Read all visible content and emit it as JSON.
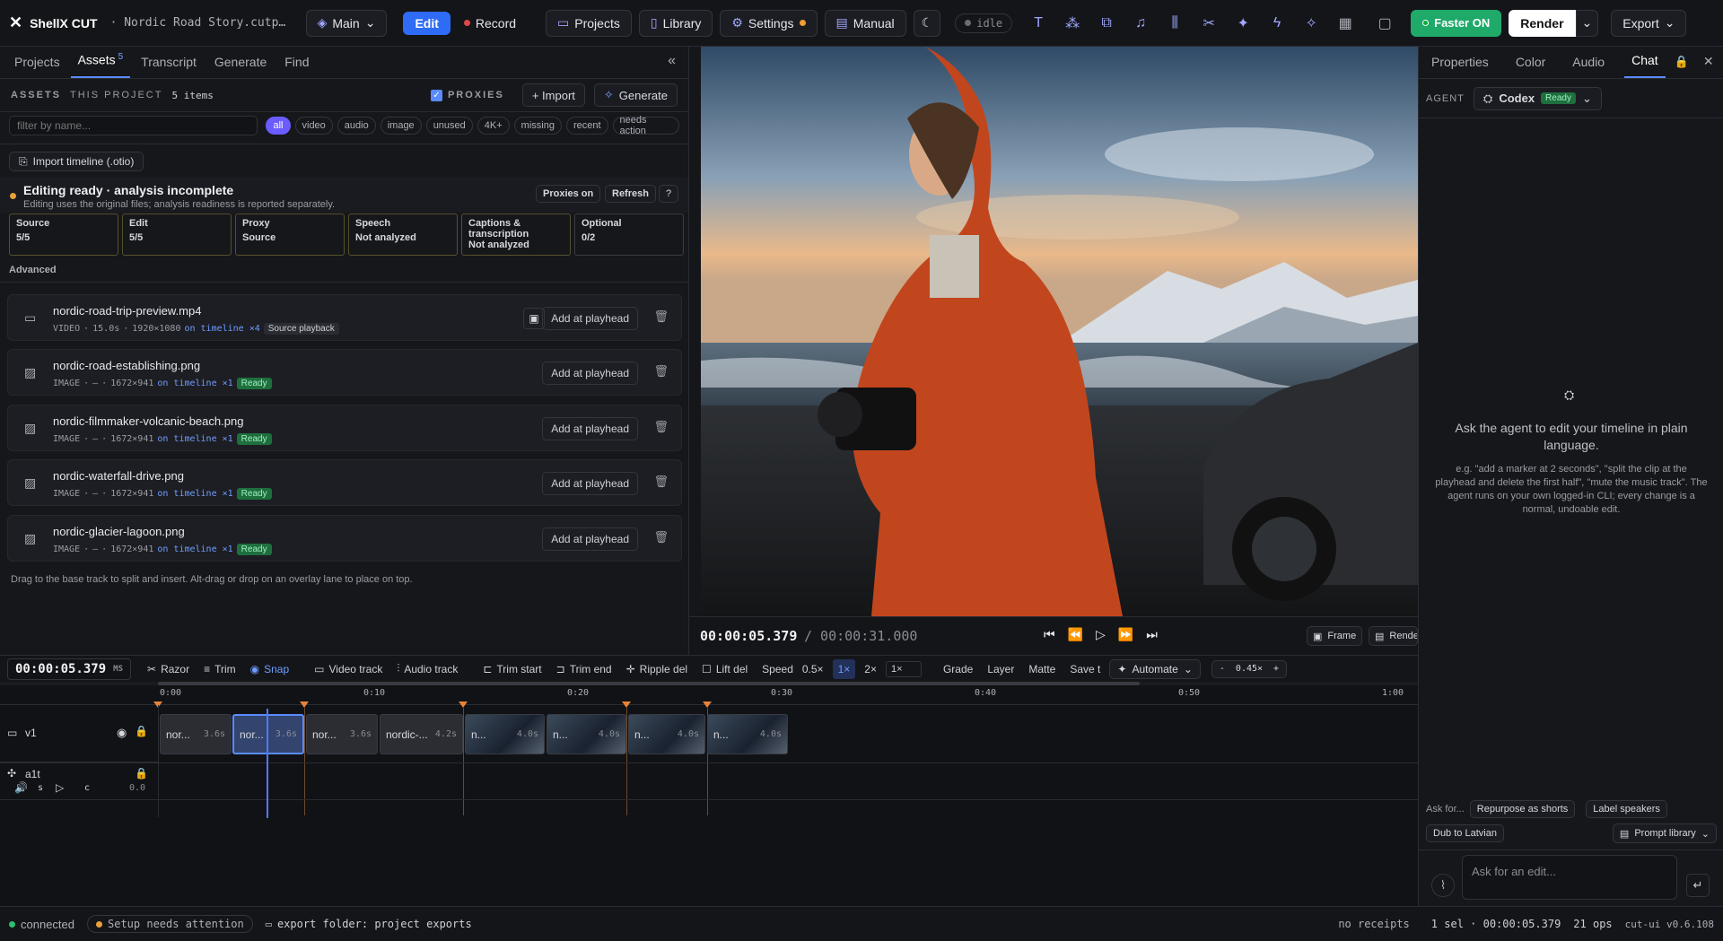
{
  "app": {
    "title": "ShellX CUT",
    "project_name": "Nordic Road Story.cutp…",
    "branch": "Main",
    "mode_edit": "Edit",
    "mode_record": "Record",
    "projects": "Projects",
    "library": "Library",
    "settings": "Settings",
    "manual": "Manual",
    "status": "idle",
    "faster": "Faster ON",
    "render": "Render",
    "export": "Export"
  },
  "left": {
    "tabs": [
      "Projects",
      "Assets",
      "Transcript",
      "Generate",
      "Find"
    ],
    "assets_count": "5",
    "assets_label": "ASSETS",
    "scope_label": "THIS PROJECT",
    "items_count": "5 items",
    "proxies_label": "PROXIES",
    "import_btn": "+ Import",
    "generate_btn": "Generate",
    "filter_placeholder": "filter by name...",
    "chips": [
      "all",
      "video",
      "audio",
      "image",
      "unused",
      "4K+",
      "missing",
      "recent",
      "needs action"
    ],
    "import_timeline": "Import timeline (.otio)",
    "status_title": "Editing ready · analysis incomplete",
    "status_sub": "Editing uses the original files; analysis readiness is reported separately.",
    "proxies_on": "Proxies on",
    "refresh": "Refresh",
    "help": "?",
    "stats": [
      {
        "label": "Source",
        "value": "5/5"
      },
      {
        "label": "Edit",
        "value": "5/5"
      },
      {
        "label": "Proxy",
        "value": "Source"
      },
      {
        "label": "Speech",
        "value": "Not analyzed"
      },
      {
        "label": "Captions & transcription",
        "value": "Not analyzed"
      },
      {
        "label": "Optional",
        "value": "0/2"
      }
    ],
    "advanced": "Advanced",
    "assets": [
      {
        "name": "nordic-road-trip-preview.mp4",
        "type": "VIDEO",
        "dur": "15.0s",
        "res": "1920×1080",
        "usage": "on timeline ×4",
        "badge": "Source playback",
        "kind": "video"
      },
      {
        "name": "nordic-road-establishing.png",
        "type": "IMAGE",
        "dur": "—",
        "res": "1672×941",
        "usage": "on timeline ×1",
        "badge": "Ready",
        "kind": "image"
      },
      {
        "name": "nordic-filmmaker-volcanic-beach.png",
        "type": "IMAGE",
        "dur": "—",
        "res": "1672×941",
        "usage": "on timeline ×1",
        "badge": "Ready",
        "kind": "image"
      },
      {
        "name": "nordic-waterfall-drive.png",
        "type": "IMAGE",
        "dur": "—",
        "res": "1672×941",
        "usage": "on timeline ×1",
        "badge": "Ready",
        "kind": "image"
      },
      {
        "name": "nordic-glacier-lagoon.png",
        "type": "IMAGE",
        "dur": "—",
        "res": "1672×941",
        "usage": "on timeline ×1",
        "badge": "Ready",
        "kind": "image"
      }
    ],
    "add_at_playhead": "Add at playhead",
    "hint": "Drag to the base track to split and insert. Alt-drag or drop on an overlay lane to place on top."
  },
  "transport": {
    "current": "00:00:05.379",
    "total": "/ 00:00:31.000",
    "frame": "Frame",
    "render": "Render"
  },
  "right": {
    "tabs": [
      "Properties",
      "Color",
      "Audio",
      "Chat"
    ],
    "agent_label": "AGENT",
    "agent_name": "Codex",
    "agent_status": "Ready",
    "empty_title": "Ask the agent to edit your timeline in plain language.",
    "empty_examples": "e.g. \"add a marker at 2 seconds\", \"split the clip at the playhead and delete the first half\", \"mute the music track\". The agent runs on your own logged-in CLI; every change is a normal, undoable edit.",
    "ask_for": "Ask for...",
    "suggestions": [
      "Repurpose as shorts",
      "Label speakers",
      "Dub to Latvian"
    ],
    "prompt_library": "Prompt library",
    "input_placeholder": "Ask for an edit..."
  },
  "timeline": {
    "timecode": "00:00:05.379",
    "unit": "MS",
    "tools": [
      "Razor",
      "Trim",
      "Snap",
      "Video track",
      "Audio track",
      "Trim start",
      "Trim end",
      "Ripple del",
      "Lift del"
    ],
    "speed_label": "Speed",
    "speeds": [
      "0.5×",
      "1×",
      "2×"
    ],
    "speed_value": "1×",
    "grade": "Grade",
    "layer": "Layer",
    "matte": "Matte",
    "save": "Save t",
    "automate": "Automate",
    "zoom": "0.45×",
    "ruler": [
      "0:00",
      "0:10",
      "0:20",
      "0:30",
      "0:40",
      "0:50",
      "1:00"
    ],
    "v_track": "v1",
    "a_track": "a1t",
    "a_sub": [
      "s",
      "c"
    ],
    "a_gain": "0.0",
    "clips": [
      {
        "label": "nor...",
        "dur": "3.6s"
      },
      {
        "label": "nor...",
        "dur": "3.6s"
      },
      {
        "label": "nor...",
        "dur": "3.6s"
      },
      {
        "label": "nordic-...",
        "dur": "4.2s"
      },
      {
        "label": "n...",
        "dur": "4.0s"
      },
      {
        "label": "n...",
        "dur": "4.0s"
      },
      {
        "label": "n...",
        "dur": "4.0s"
      },
      {
        "label": "n...",
        "dur": "4.0s"
      }
    ]
  },
  "statusbar": {
    "connected": "connected",
    "setup": "Setup needs attention",
    "export_folder": "export folder: project exports",
    "receipts": "no receipts",
    "selection": "1 sel · 00:00:05.379",
    "ops": "21 ops",
    "version": "cut-ui v0.6.108"
  }
}
